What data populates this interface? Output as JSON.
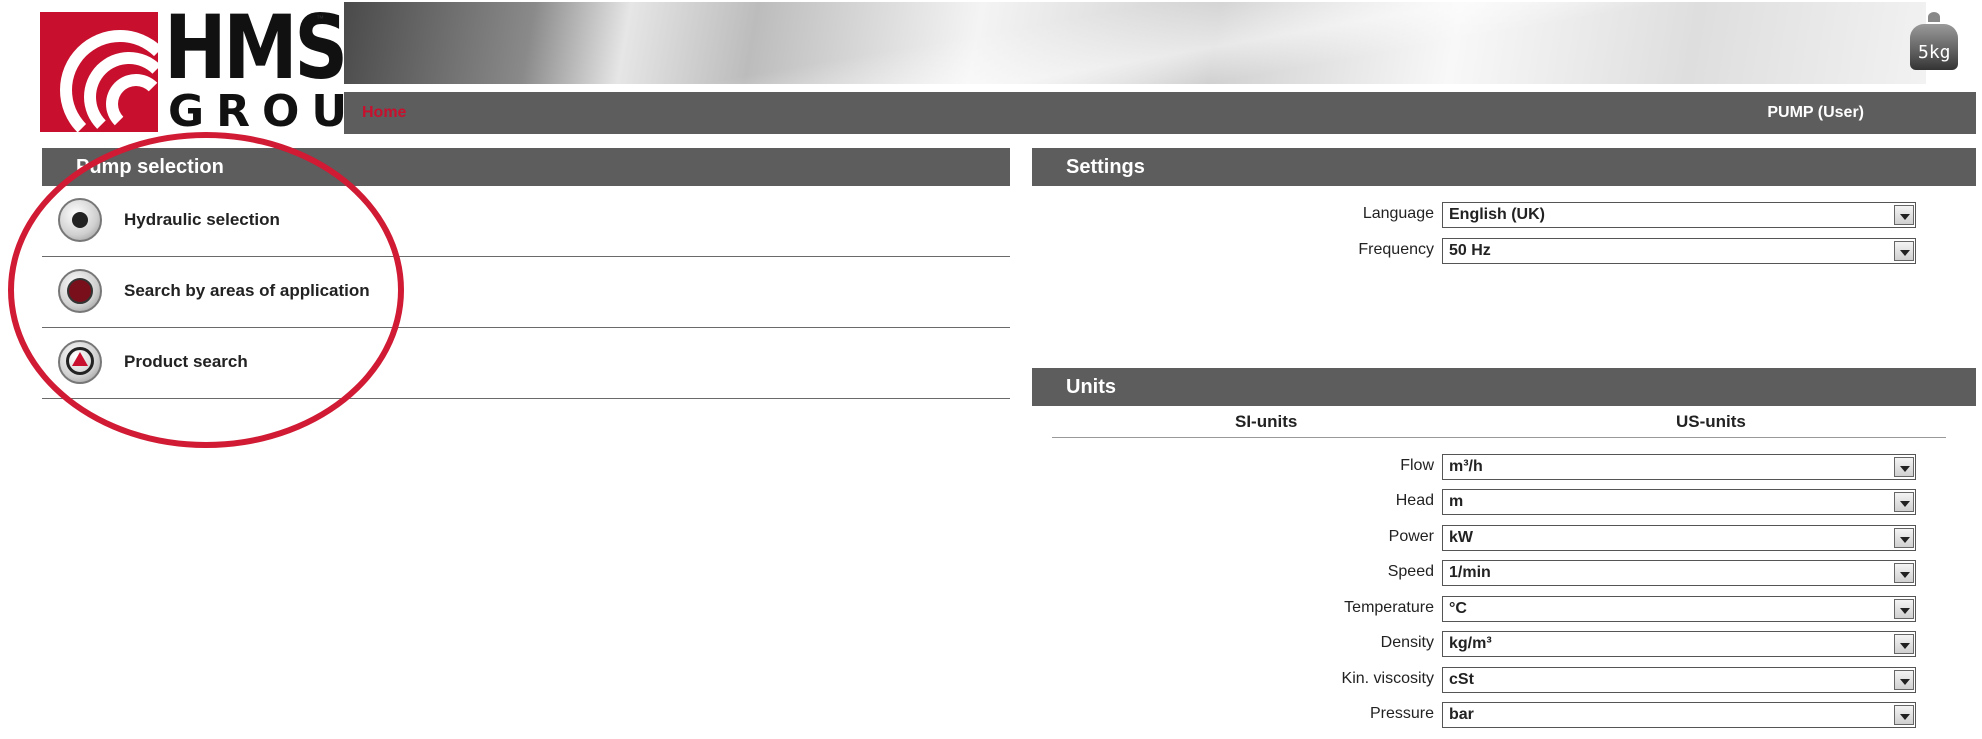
{
  "brand": {
    "line1": "HMS",
    "line2": "GROUP",
    "tm": "™",
    "icon": "weight-5kg-icon",
    "weight_label": "5kg",
    "accent_color": "#c8102e"
  },
  "navbar": {
    "home": "Home",
    "user": "PUMP (User)"
  },
  "pump_selection": {
    "title": "Pump selection",
    "items": [
      {
        "label": "Hydraulic selection",
        "icon": "radio-disc-icon"
      },
      {
        "label": "Search by areas of application",
        "icon": "globe-icon"
      },
      {
        "label": "Product search",
        "icon": "magnifier-icon"
      }
    ]
  },
  "settings": {
    "title": "Settings",
    "fields": [
      {
        "label": "Language",
        "value": "English (UK)"
      },
      {
        "label": "Frequency",
        "value": "50 Hz"
      }
    ]
  },
  "units": {
    "title": "Units",
    "si_label": "SI-units",
    "us_label": "US-units",
    "fields": [
      {
        "label": "Flow",
        "value": "m³/h"
      },
      {
        "label": "Head",
        "value": "m"
      },
      {
        "label": "Power",
        "value": "kW"
      },
      {
        "label": "Speed",
        "value": "1/min"
      },
      {
        "label": "Temperature",
        "value": "°C"
      },
      {
        "label": "Density",
        "value": "kg/m³"
      },
      {
        "label": "Kin. viscosity",
        "value": "cSt"
      },
      {
        "label": "Pressure",
        "value": "bar"
      }
    ]
  }
}
